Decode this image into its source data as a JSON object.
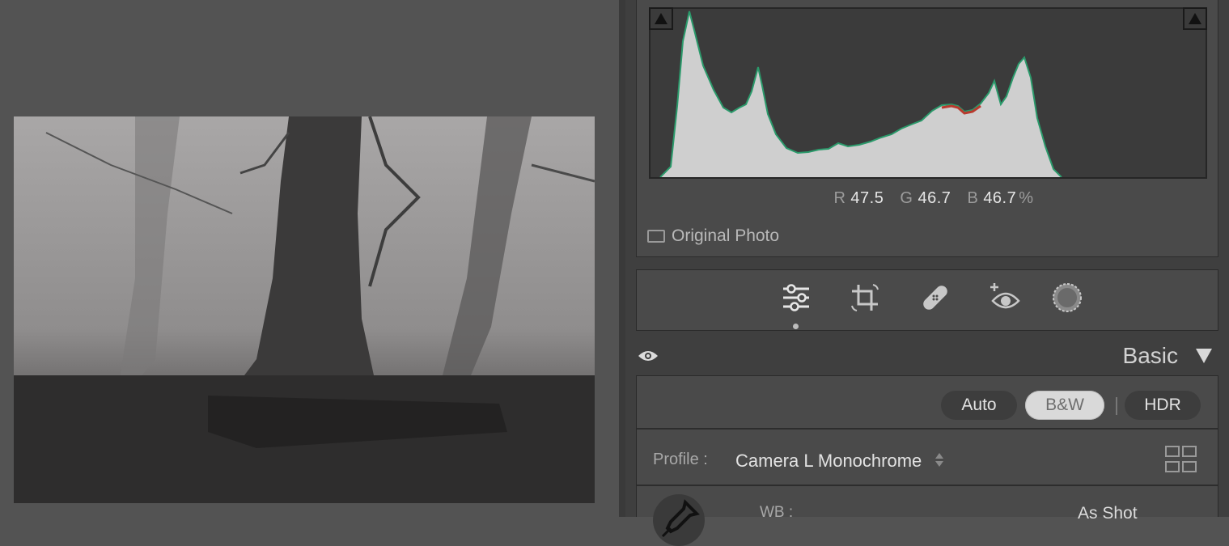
{
  "histogram": {
    "r_label": "R",
    "r_value": "47.5",
    "g_label": "G",
    "g_value": "46.7",
    "b_label": "B",
    "b_value": "46.7",
    "unit": "%",
    "original_photo_label": "Original Photo"
  },
  "tools": [
    {
      "name": "edit-sliders-icon",
      "active": true
    },
    {
      "name": "crop-rotate-icon"
    },
    {
      "name": "healing-bandage-icon"
    },
    {
      "name": "red-eye-icon"
    },
    {
      "name": "masking-icon"
    }
  ],
  "basic": {
    "title": "Basic",
    "auto_label": "Auto",
    "bw_label": "B&W",
    "hdr_label": "HDR",
    "profile_label": "Profile :",
    "profile_value": "Camera L Monochrome",
    "wb_label": "WB :",
    "wb_value": "As Shot"
  },
  "colors": {
    "panel_bg": "#4a4a4a",
    "histogram_fill": "#cfcfcf",
    "active_pill": "#d9d9d9"
  }
}
